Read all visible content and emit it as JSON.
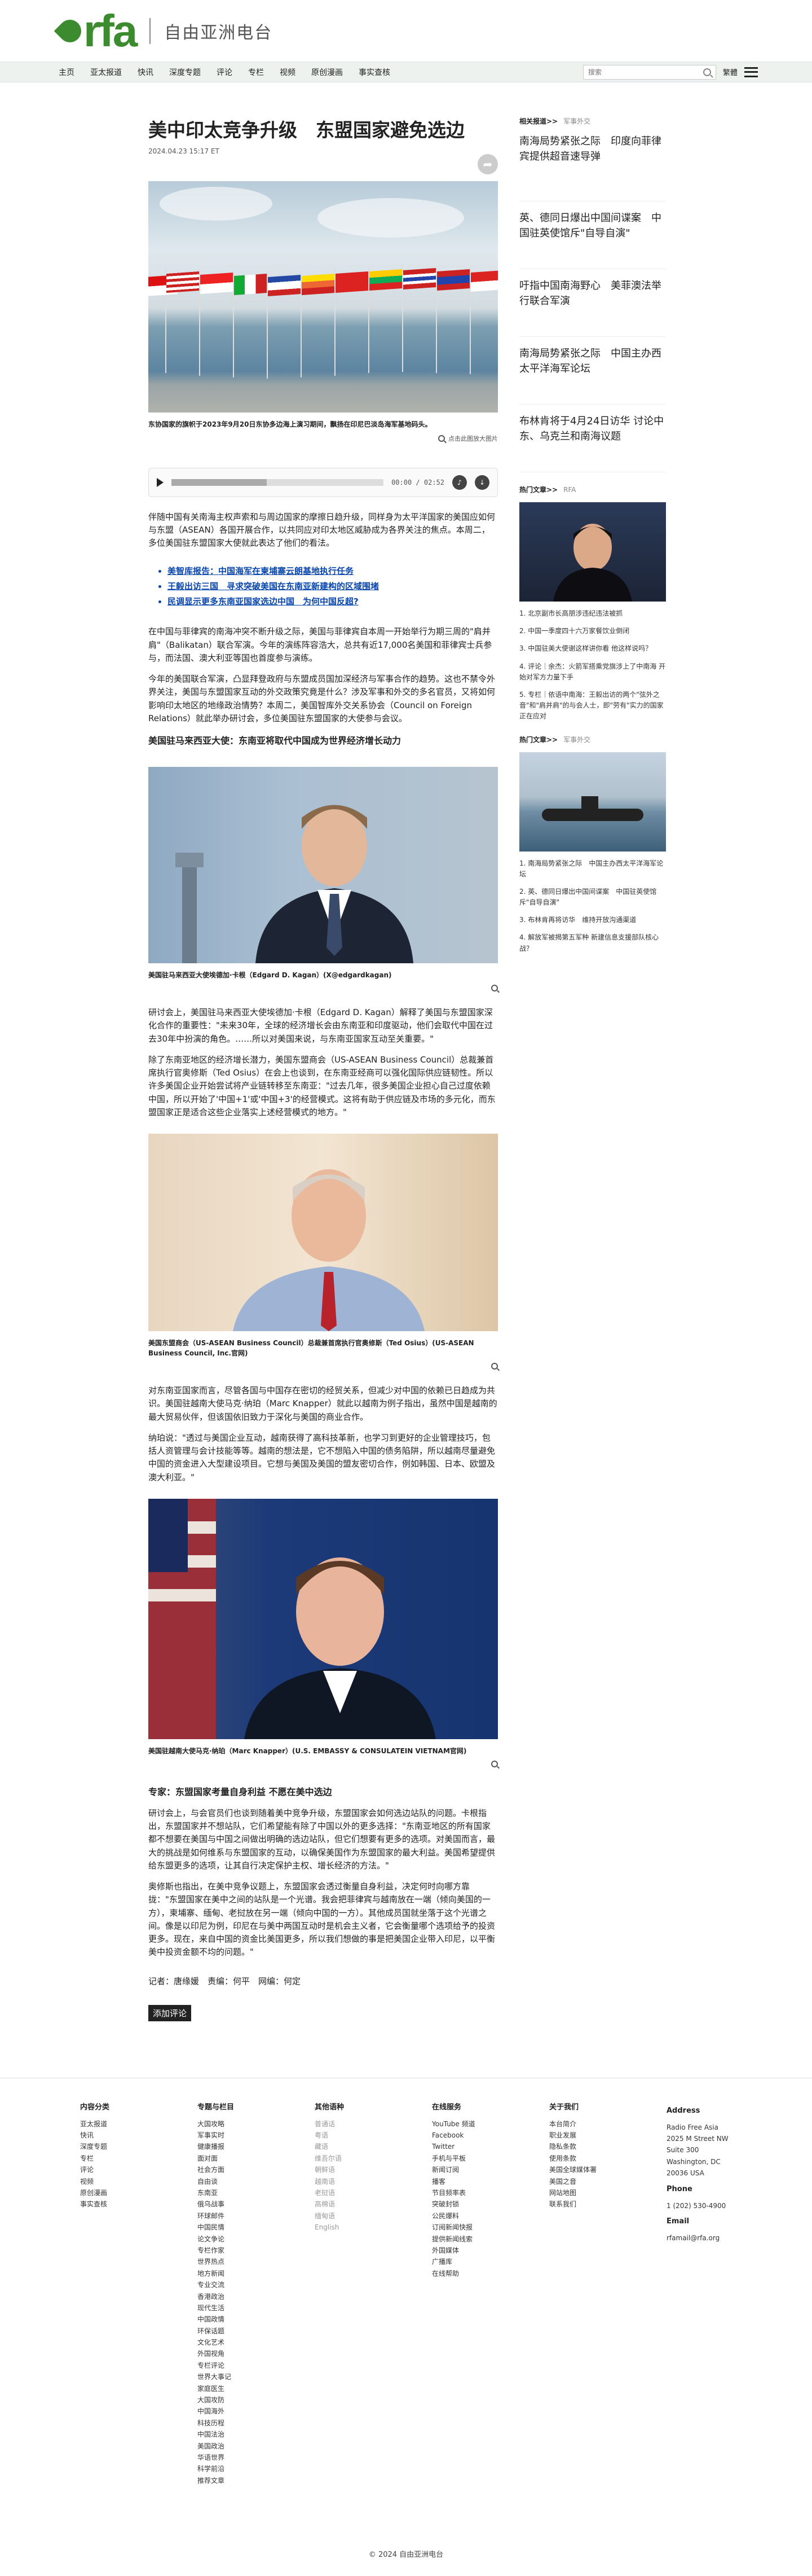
{
  "header": {
    "logo_text": "rfa",
    "site_name": "自由亚洲电台"
  },
  "nav": {
    "items": [
      "主页",
      "亚太报道",
      "快讯",
      "深度专题",
      "评论",
      "专栏",
      "视频",
      "原创漫画",
      "事实查核"
    ],
    "search_placeholder": "搜索",
    "lang": "繁體"
  },
  "article": {
    "title": "美中印太竞争升级　东盟国家避免选边",
    "date": "2024.04.23 15:17 ET",
    "image1_caption": "东协国家的旗帜于2023年9月20日东协多边海上演习期间，飘扬在印尼巴淡岛海军基地码头。",
    "enlarge_label": "点击此图放大图片",
    "audio": {
      "time": "00:00 / 02:52",
      "progress": 0.45
    },
    "p1": "伴随中国有关南海主权声索和与周边国家的摩擦日趋升级，同样身为太平洋国家的美国应如何与东盟（ASEAN）各国开展合作，以共同应对印太地区威胁成为各界关注的焦点。本周二，多位美国驻东盟国家大使就此表达了他们的看法。",
    "related": [
      "美智库报告：中国海军在柬埔寨云朗基地执行任务",
      "王毅出访三国　寻求突破美国在东南亚新建构的区域围堵",
      "民调显示更多东南亚国家选边中国　为何中国反超?"
    ],
    "p2": "在中国与菲律宾的南海冲突不断升级之际，美国与菲律宾自本周一开始举行为期三周的\"肩并肩\"（Balikatan）联合军演。今年的演练阵容浩大，总共有近17,000名美国和菲律宾士兵参与，而法国、澳大利亚等国也首度参与演练。",
    "p3": "今年的美国联合军演，凸显拜登政府与东盟成员国加深经济与军事合作的趋势。这也不禁令外界关注，美国与东盟国家互动的外交政策究竟是什么？涉及军事和外交的多名官员，又将如何影响印太地区的地缘政治情势？本周二，美国智库外交关系协会（Council on Foreign Relations）就此举办研讨会，多位美国驻东盟国家的大使参与会议。",
    "subhead1": "美国驻马来西亚大使：东南亚将取代中国成为世界经济增长动力",
    "image2_caption": "美国驻马来西亚大使埃德加·卡根（Edgard D. Kagan）(X@edgardkagan)",
    "p4": "研讨会上，美国驻马来西亚大使埃德加·卡根（Edgard D. Kagan）解释了美国与东盟国家深化合作的重要性：\"未来30年，全球的经济增长会由东南亚和印度驱动，他们会取代中国在过去30年中扮演的角色。……所以对美国来说，与东南亚国家互动至关重要。\"",
    "p5": "除了东南亚地区的经济增长潜力，美国东盟商会（US-ASEAN Business Council）总裁兼首席执行官奥修斯（Ted Osius）在会上也谈到，在东南亚经商可以强化国际供应链韧性。所以许多美国企业开始尝试将产业链转移至东南亚：\"过去几年，很多美国企业担心自己过度依赖中国，所以开始了'中国+1'或'中国+3'的经营模式。这将有助于供应链及市场的多元化，而东盟国家正是适合这些企业落实上述经营模式的地方。\"",
    "image3_caption": "美国东盟商会（US-ASEAN Business Council）总裁兼首席执行官奥修斯（Ted Osius）(US-ASEAN Business Council, Inc.官网)",
    "p6": "对东南亚国家而言，尽管各国与中国存在密切的经贸关系，但减少对中国的依赖已日趋成为共识。美国驻越南大使马克·纳珀（Marc Knapper）就此以越南为例子指出，虽然中国是越南的最大贸易伙伴，但该国依旧致力于深化与美国的商业合作。",
    "p7": "纳珀说：\"透过与美国企业互动，越南获得了高科技革新，也学习到更好的企业管理技巧，包括人资管理与会计技能等等。越南的想法是，它不想陷入中国的债务陷阱，所以越南尽量避免中国的资金进入大型建设项目。它想与美国及美国的盟友密切合作，例如韩国、日本、欧盟及澳大利亚。\"",
    "image4_caption": "美国驻越南大使马克·纳珀（Marc Knapper）(U.S. EMBASSY & CONSULATEIN VIETNAM官网)",
    "subhead2": "专家：东盟国家考量自身利益 不愿在美中选边",
    "p8": "研讨会上，与会官员们也谈到随着美中竞争升级，东盟国家会如何选边站队的问题。卡根指出，东盟国家并不想站队，它们希望能有除了中国以外的更多选择：\"东南亚地区的所有国家都不想要在美国与中国之间做出明确的选边站队，但它们想要有更多的选项。对美国而言，最大的挑战是如何维系与东盟国家的互动，以确保美国作为东盟国家的最大利益。美国希望提供给东盟更多的选项，让其自行决定保护主权、增长经济的方法。\"",
    "p9": "奥修斯也指出，在美中竞争议题上，东盟国家会透过衡量自身利益，决定何时向哪方靠拢：\"东盟国家在美中之间的站队是一个光谱。我会把菲律宾与越南放在一端（倾向美国的一方），柬埔寨、缅甸、老挝放在另一端（倾向中国的一方）。其他成员国就坐落于这个光谱之间。像是以印尼为例，印尼在与美中两国互动时是机会主义者，它会衡量哪个选项给予的投资更多。现在，来自中国的资金比美国更多，所以我们想做的事是把美国企业带入印尼，以平衡美中投资金额不均的问题。\"",
    "byline": "记者：唐缘媛　责编：何平　网编：何定",
    "comment_button": "添加评论"
  },
  "sidebar": {
    "related_head": "相关报道>>",
    "related_tag": "军事外交",
    "related": [
      "南海局势紧张之际　印度向菲律宾提供超音速导弹",
      "英、德同日爆出中国间谍案　中国驻英使馆斥\"自导自演\"",
      "吁指中国南海野心　美菲澳法举行联合军演",
      "南海局势紧张之际　中国主办西太平洋海军论坛",
      "布林肯将于4月24日访华 讨论中东、乌克兰和南海议题"
    ],
    "hot1_head": "热门文章>>",
    "hot1_tag": "RFA",
    "hot1": [
      "1. 北京副市长高朋涉违纪违法被抓",
      "2. 中国一季度四十六万家餐饮业倒闭",
      "3. 中国驻美大使谢这样讲你看 他这样说吗？",
      "4. 评论｜余杰：火箭军搭乘党旗涉上了中南海 开始对军方力量下手",
      "5. 专栏｜依语中南海：王毅出访的两个\"弦外之音\"和\"肩并肩\"的与会人士，即\"劳有\"实力的国家正在应对"
    ],
    "hot2_head": "热门文章>>",
    "hot2_tag": "军事外交",
    "hot2": [
      "1. 南海局势紧张之际　中国主办西太平洋海军论坛",
      "2. 英、德同日爆出中国间谍案　中国驻英使馆斥\"自导自演\"",
      "3. 布林肯再将访华　维持开放沟通渠道",
      "4. 解放军被揭第五军种 新建信息支援部队核心战？"
    ]
  },
  "footer": {
    "cols": [
      {
        "title": "内容分类",
        "items": [
          "亚太报道",
          "快讯",
          "深度专题",
          "专栏",
          "评论",
          "视频",
          "原创漫画",
          "事实查核"
        ]
      },
      {
        "title": "专题与栏目",
        "items": [
          "大国攻略",
          "军事实时",
          "健康播报",
          "面对面",
          "社会方面",
          "自由谈",
          "东南亚",
          "俄乌战事",
          "环球邮件",
          "中国民情",
          "论文争论",
          "专栏作家",
          "世界热点",
          "地方新闻",
          "专业交流",
          "香港政治",
          "现代生活",
          "中国政情",
          "环保话题",
          "文化艺术",
          "外国视角",
          "专栏评论",
          "世界大事记",
          "家庭医生",
          "大国攻防",
          "中国海外",
          "科技历程",
          "中国法治",
          "美国政治",
          "华语世界",
          "科学前沿",
          "推荐文章"
        ]
      },
      {
        "title": "其他语种",
        "items": [
          "普通话",
          "粤语",
          "藏语",
          "维吾尔语",
          "朝鲜语",
          "越南语",
          "老挝语",
          "高棉语",
          "缅甸语",
          "English"
        ],
        "muted": true
      },
      {
        "title": "在线服务",
        "items": [
          "YouTube 频道",
          "Facebook",
          "Twitter",
          "手机与平板",
          "新闻订阅",
          "播客",
          "节目频率表",
          "突破封锁",
          "公民爆料",
          "订阅新闻快报",
          "提供新闻线索",
          "外国媒体",
          "广播库",
          "在线帮助"
        ]
      },
      {
        "title": "关于我们",
        "items": [
          "本台简介",
          "职业发展",
          "隐私条款",
          "使用条款",
          "美国全球媒体署",
          "美国之音",
          "网站地图",
          "联系我们"
        ]
      },
      {
        "title": "Address",
        "items": [
          "Radio Free Asia",
          "2025 M Street NW",
          "Suite 300",
          "Washington, DC",
          "20036 USA"
        ],
        "phone_title": "Phone",
        "phone": "1 (202) 530-4900",
        "email_title": "Email",
        "email": "rfamail@rfa.org"
      }
    ],
    "copyright": "© 2024 自由亚洲电台"
  },
  "colors": {
    "brand": "#3d8b2f",
    "link": "#0645ad"
  },
  "icons": [
    "search-icon",
    "menu-icon",
    "share-icon",
    "play-icon",
    "zoom-icon"
  ]
}
